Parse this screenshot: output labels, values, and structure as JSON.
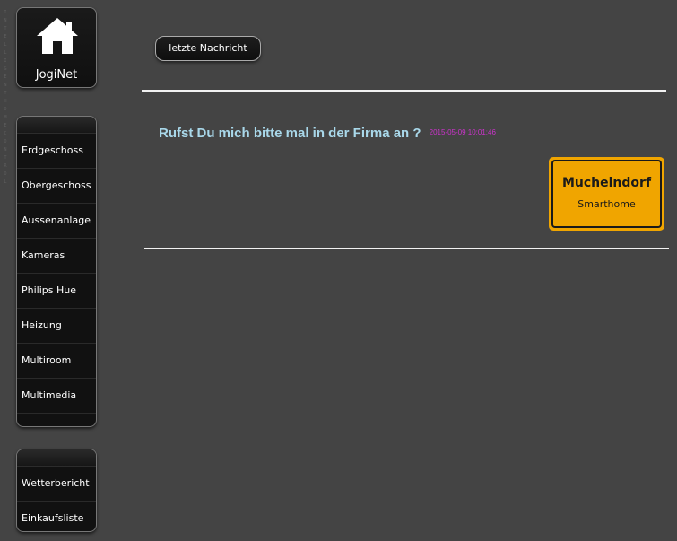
{
  "sidebar": {
    "vertical_text": "INTELLIGENT HOME CONTROL",
    "logo": {
      "label": "JogiNet",
      "icon": "house-icon"
    },
    "main_menu": [
      {
        "label": "Erdgeschoss"
      },
      {
        "label": "Obergeschoss"
      },
      {
        "label": "Aussenanlage"
      },
      {
        "label": "Kameras"
      },
      {
        "label": "Philips Hue"
      },
      {
        "label": "Heizung"
      },
      {
        "label": "Multiroom"
      },
      {
        "label": "Multimedia"
      }
    ],
    "extra_menu": [
      {
        "label": "Wetterbericht"
      },
      {
        "label": "Einkaufsliste"
      }
    ]
  },
  "main": {
    "last_message_button": "letzte Nachricht",
    "message": {
      "text": "Rufst Du mich bitte mal in der Firma an ?",
      "timestamp": "2015-05-09 10:01:46"
    },
    "town_sign": {
      "name": "Muchelndorf",
      "subtitle": "Smarthome"
    }
  },
  "colors": {
    "background": "#444444",
    "message_text": "#a9d8ea",
    "timestamp": "#cc33cc",
    "sign_yellow": "#f0a500"
  }
}
